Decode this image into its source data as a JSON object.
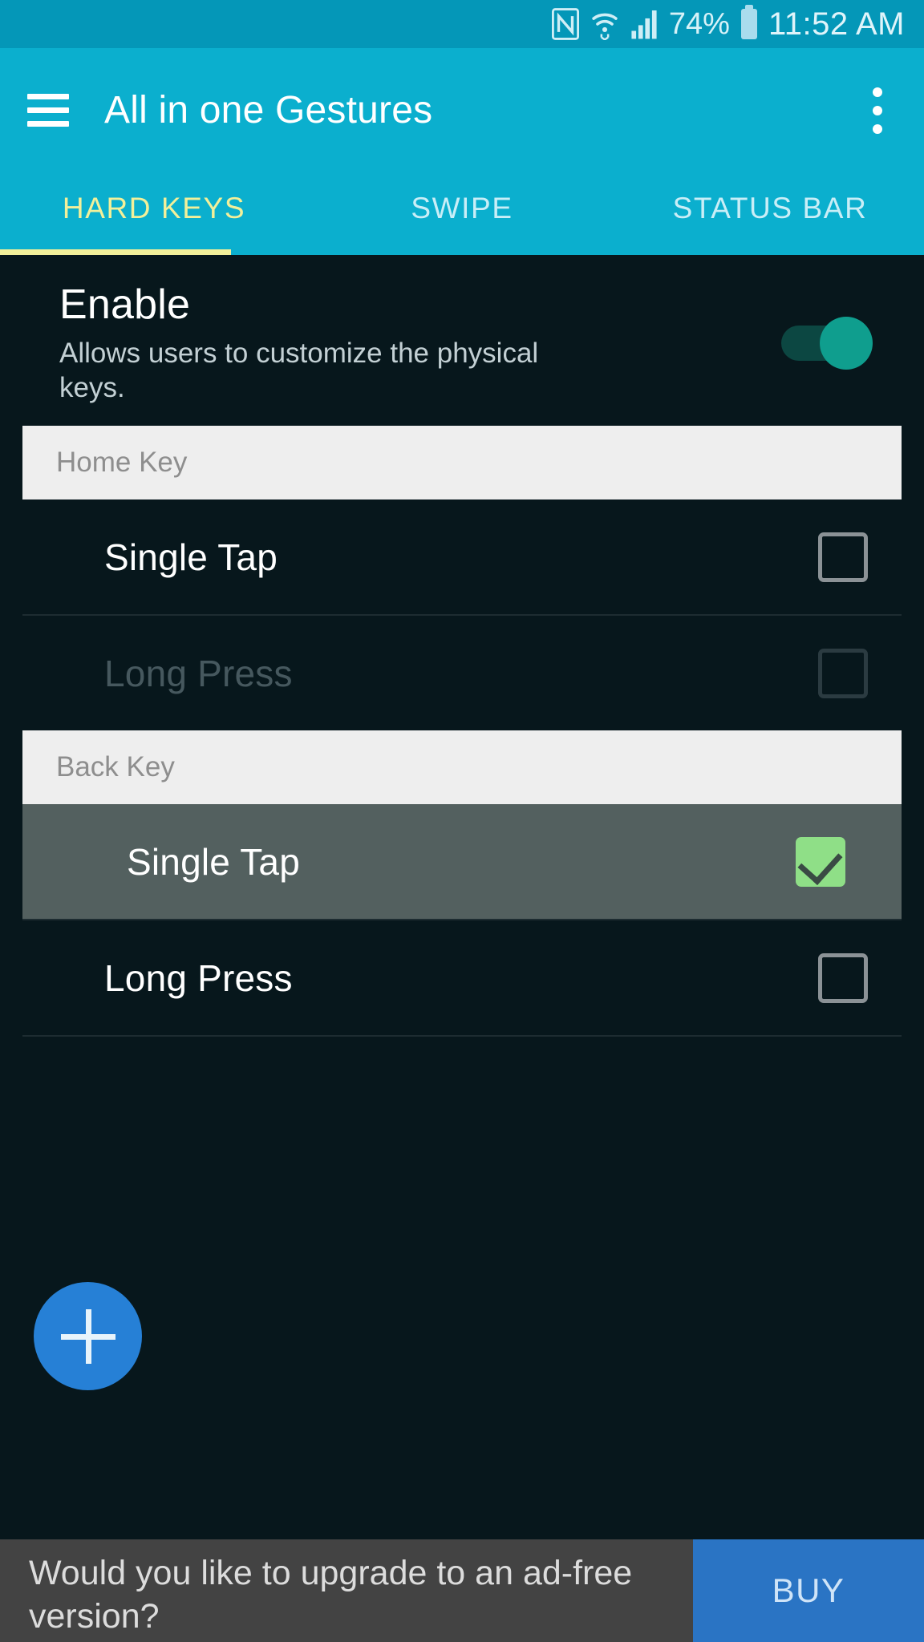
{
  "status_bar": {
    "nfc_icon": "nfc-icon",
    "wifi_icon": "wifi-icon",
    "signal_icon": "cellular-signal-icon",
    "battery_percent": "74%",
    "battery_icon": "battery-icon",
    "time": "11:52 AM"
  },
  "app_bar": {
    "menu_icon": "hamburger-menu-icon",
    "title": "All in one Gestures",
    "overflow_icon": "overflow-menu-icon"
  },
  "tabs": [
    {
      "label": "HARD KEYS",
      "active": true
    },
    {
      "label": "SWIPE",
      "active": false
    },
    {
      "label": "STATUS BAR",
      "active": false
    }
  ],
  "enable": {
    "title": "Enable",
    "subtitle": "Allows users to customize the physical keys.",
    "toggle_state": "on"
  },
  "sections": [
    {
      "header": "Home Key",
      "items": [
        {
          "label": "Single Tap",
          "checked": false,
          "dim": false,
          "highlight": false
        },
        {
          "label": "Long Press",
          "checked": false,
          "dim": true,
          "highlight": false
        }
      ]
    },
    {
      "header": "Back Key",
      "items": [
        {
          "label": "Single Tap",
          "checked": true,
          "dim": false,
          "highlight": true
        },
        {
          "label": "Long Press",
          "checked": false,
          "dim": false,
          "highlight": false
        }
      ]
    }
  ],
  "fab": {
    "icon": "plus-icon",
    "label": "+"
  },
  "banner": {
    "message": "Would you like to upgrade to an ad-free version?",
    "buy_label": "BUY"
  },
  "colors": {
    "accent": "#0bafce",
    "status_bar": "#0497b8",
    "tab_active": "#f2f09a",
    "content_bg": "#07171c",
    "section_header_bg": "#eeeeee",
    "checkbox_checked": "#8fdf87",
    "toggle_on": "#0f9e8e",
    "fab": "#2680d6",
    "banner_bg": "#434343",
    "buy_bg": "#2a74c4",
    "row_highlight": "#53605f"
  }
}
